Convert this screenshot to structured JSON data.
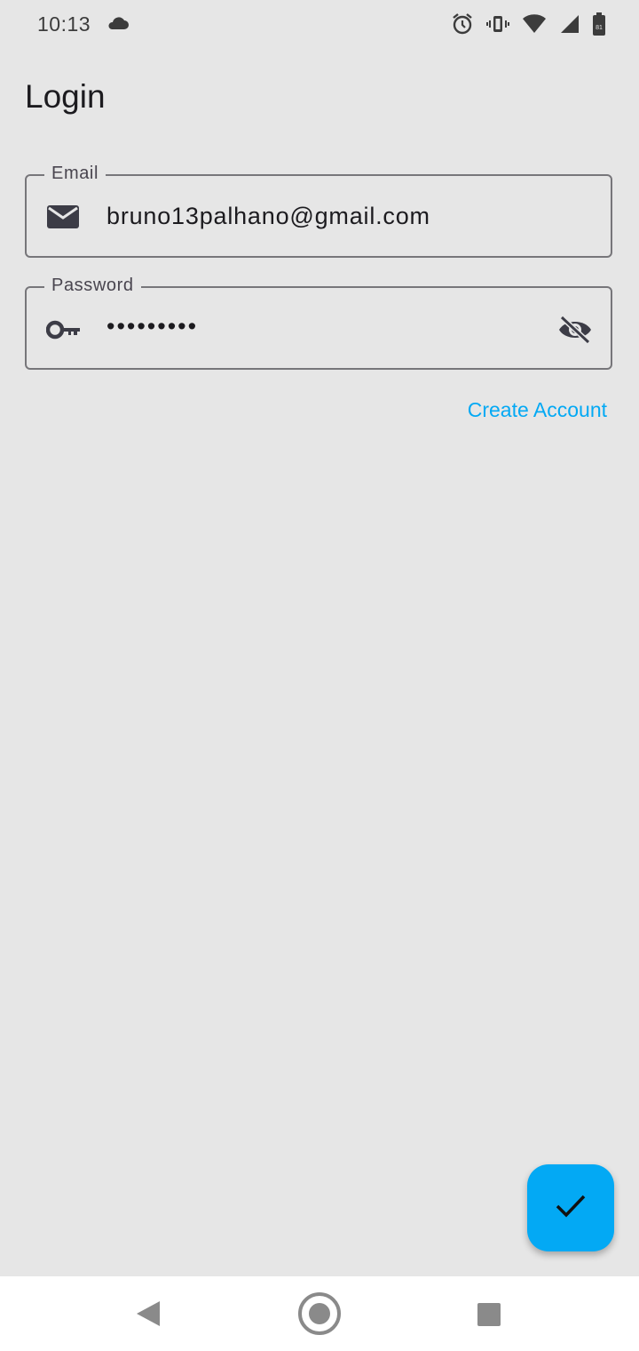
{
  "status_bar": {
    "time": "10:13",
    "left_icons": [
      "cloud-icon"
    ],
    "right_icons": [
      "alarm-icon",
      "vibrate-icon",
      "wifi-icon",
      "signal-icon",
      "battery-icon"
    ],
    "battery_text": "81"
  },
  "page": {
    "title": "Login"
  },
  "email_field": {
    "label": "Email",
    "value": "bruno13palhano@gmail.com",
    "icon": "email-icon"
  },
  "password_field": {
    "label": "Password",
    "value": "•••••••••",
    "leading_icon": "key-icon",
    "trailing_icon": "visibility-off-icon"
  },
  "create_account": {
    "label": "Create Account"
  },
  "fab": {
    "icon": "check-icon"
  },
  "nav_bar": {
    "buttons": [
      "back-icon",
      "home-icon",
      "recents-icon"
    ]
  },
  "colors": {
    "background": "#e6e6e6",
    "accent": "#03a9f4",
    "outline": "#77767a"
  }
}
